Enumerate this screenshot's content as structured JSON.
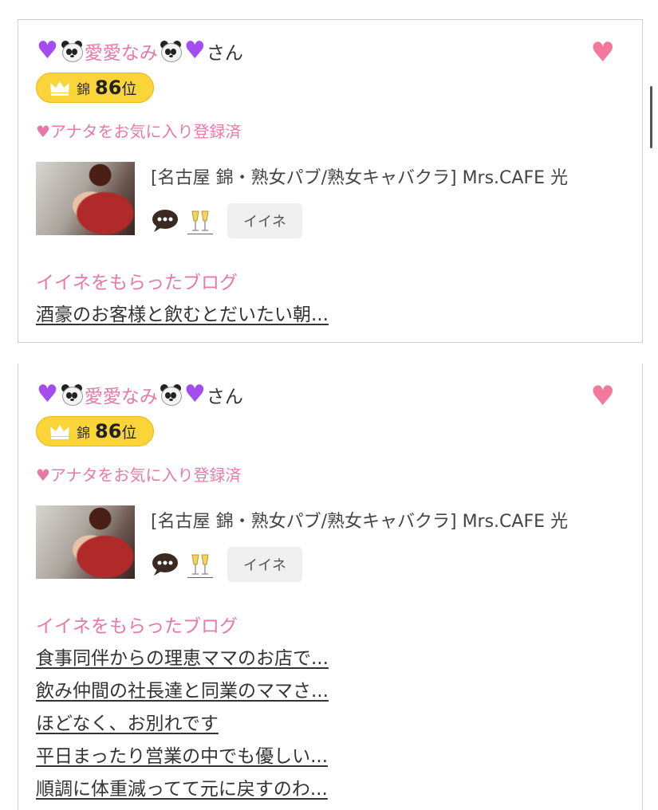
{
  "scrollbar": {},
  "cards": [
    {
      "name": "愛愛なみ",
      "honorific": "さん",
      "rank": {
        "area": "錦",
        "number": "86",
        "suffix": "位"
      },
      "favorite_status": "♥アナタをお気に入り登録済",
      "shop_info": "[名古屋 錦・熟女パブ/熟女キャバクラ]  Mrs.CAFE 光",
      "iine_label": "イイネ",
      "blog_header": "イイネをもらったブログ",
      "blogs": [
        "酒豪のお客様と飲むとだいたい朝..."
      ]
    },
    {
      "name": "愛愛なみ",
      "honorific": "さん",
      "rank": {
        "area": "錦",
        "number": "86",
        "suffix": "位"
      },
      "favorite_status": "♥アナタをお気に入り登録済",
      "shop_info": "[名古屋 錦・熟女パブ/熟女キャバクラ]  Mrs.CAFE 光",
      "iine_label": "イイネ",
      "blog_header": "イイネをもらったブログ",
      "blogs": [
        "食事同伴からの理恵ママのお店で...",
        "飲み仲間の社長達と同業のママさ...",
        "ほどなく、お別れです",
        "平日まったり営業の中でも優しい...",
        "順調に体重減ってて元に戻すのわ..."
      ]
    }
  ],
  "colors": {
    "accent_pink": "#e878aa",
    "badge_gold": "#fbd43a",
    "heart": "#f2799c",
    "purple_heart": "#a34df0"
  },
  "icons": [
    "purple-heart-icon",
    "panda-icon",
    "favorite-heart-icon",
    "crown-icon",
    "chat-bubble-icon",
    "champagne-glasses-icon"
  ]
}
